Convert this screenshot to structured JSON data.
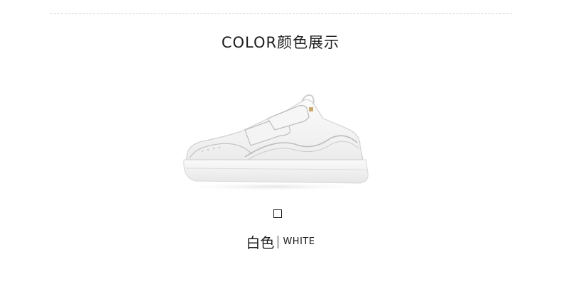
{
  "section": {
    "title_en": "COLOR",
    "title_cn": "颜色展示"
  },
  "product": {
    "image_alt": "white-velcro-sneaker",
    "color_name_cn": "白色",
    "color_name_en": "WHITE",
    "swatch_color": "#ffffff"
  },
  "colors": {
    "divider": "#cfcfcf",
    "text": "#1d1d1d"
  }
}
